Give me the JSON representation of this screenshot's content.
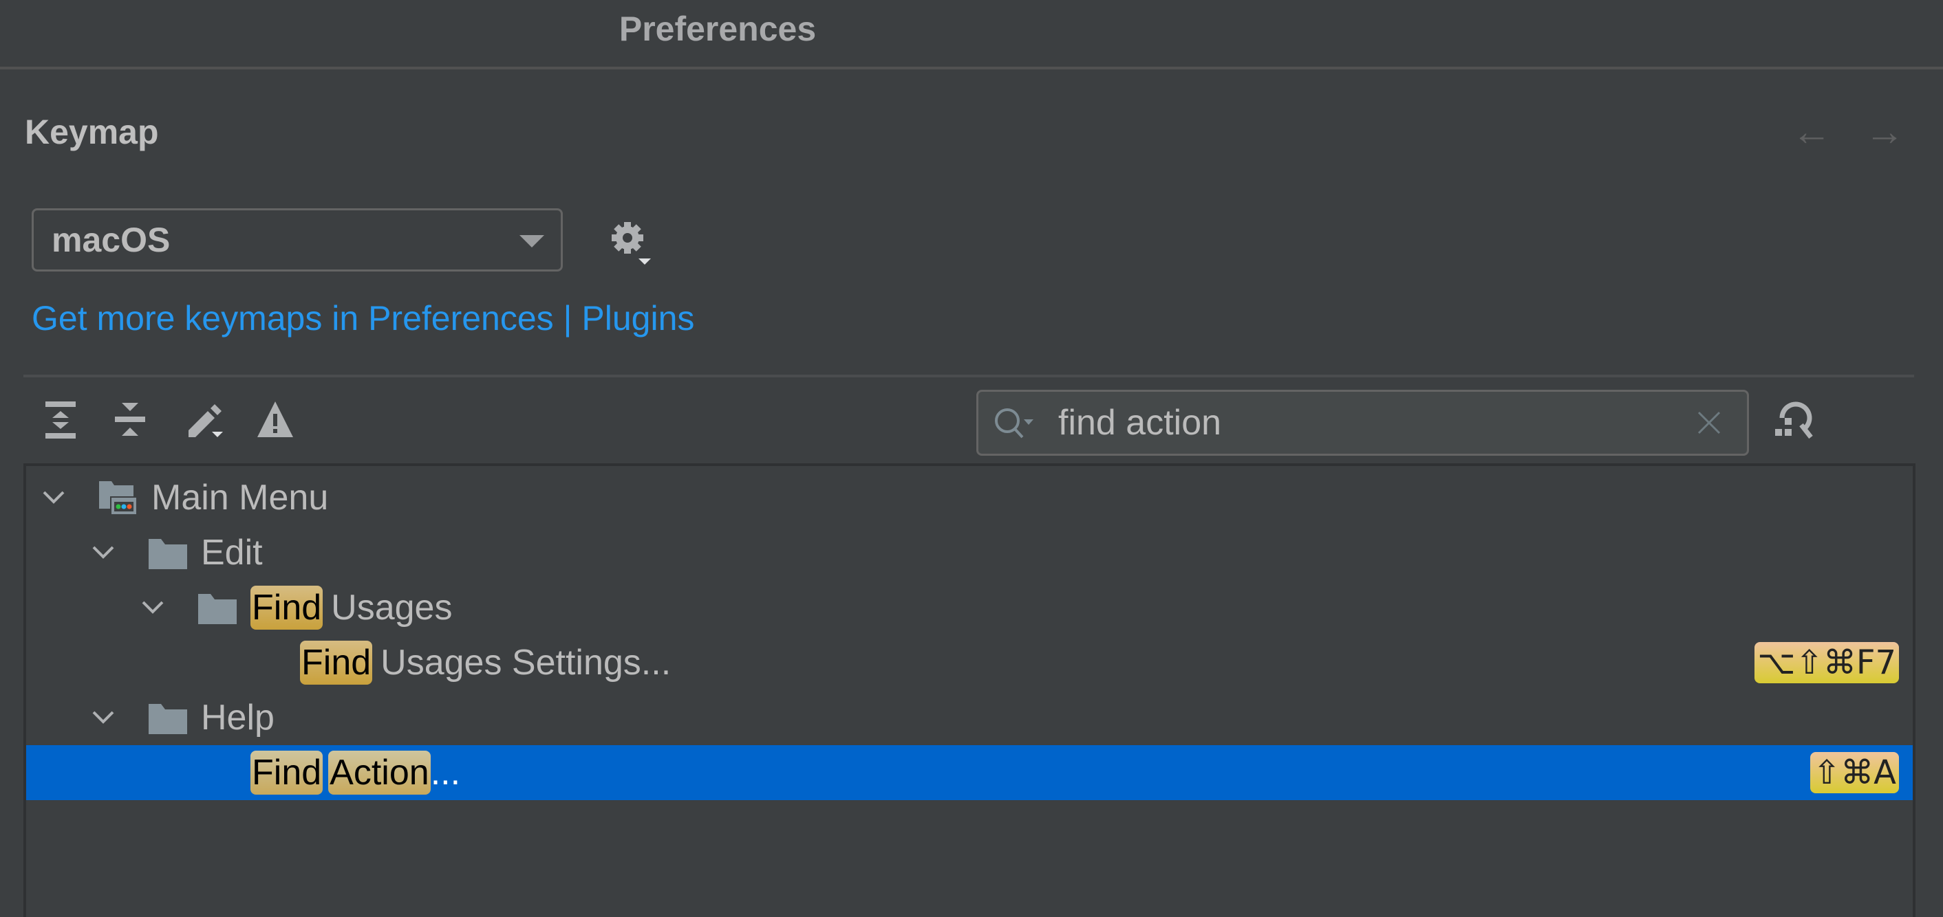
{
  "window": {
    "title": "Preferences"
  },
  "page": {
    "heading": "Keymap",
    "nav": {
      "back_icon": "arrow-left-icon",
      "forward_icon": "arrow-right-icon",
      "back_glyph": "←",
      "forward_glyph": "→"
    }
  },
  "keymap_select": {
    "value": "macOS",
    "icon": "chevron-down-icon"
  },
  "gear": {
    "icon": "gear-icon"
  },
  "plugins_link": {
    "text": "Get more keymaps in Preferences | Plugins"
  },
  "toolbar": {
    "items": [
      {
        "name": "expand-all",
        "icon": "expand-all-icon"
      },
      {
        "name": "collapse-all",
        "icon": "collapse-all-icon"
      },
      {
        "name": "edit-shortcut",
        "icon": "pencil-icon"
      },
      {
        "name": "show-conflicts",
        "icon": "warning-icon"
      }
    ]
  },
  "search": {
    "value": "find action",
    "placeholder": "",
    "icon": "search-icon",
    "clear_icon": "close-icon",
    "find_by_shortcut_icon": "find-by-shortcut-icon"
  },
  "tree": {
    "rows": [
      {
        "level": 0,
        "expanded": true,
        "icon": "main-menu-icon",
        "highlight": [],
        "text": "Main Menu",
        "shortcut": "",
        "selected": false
      },
      {
        "level": 1,
        "expanded": true,
        "icon": "folder-icon",
        "highlight": [],
        "text": "Edit",
        "shortcut": "",
        "selected": false
      },
      {
        "level": 2,
        "expanded": true,
        "icon": "folder-icon",
        "highlight": [
          "Find"
        ],
        "text": "Usages",
        "shortcut": "",
        "selected": false
      },
      {
        "level": 3,
        "expanded": null,
        "icon": "",
        "highlight": [
          "Find"
        ],
        "text": "Usages Settings...",
        "shortcut": "⌥⇧⌘F7",
        "selected": false
      },
      {
        "level": 1,
        "expanded": true,
        "icon": "folder-icon",
        "highlight": [],
        "text": "Help",
        "shortcut": "",
        "selected": false
      },
      {
        "level": 3,
        "expanded": null,
        "icon": "",
        "highlight": [
          "Find",
          "Action"
        ],
        "text": "...",
        "shortcut": "⇧⌘A",
        "selected": true
      }
    ]
  },
  "colors": {
    "background": "#3c3f41",
    "link": "#2697ee",
    "selection": "#0064cb",
    "match_highlight": "#c9a13c",
    "shortcut_badge": "#d8cb33"
  }
}
